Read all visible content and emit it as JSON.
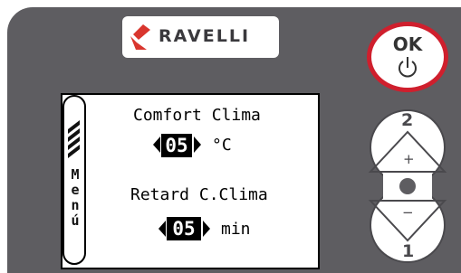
{
  "brand": {
    "name": "RAVELLI",
    "logo_color": "#d9362e"
  },
  "menu_tab": {
    "label_chars": [
      "M",
      "e",
      "n",
      "ú"
    ],
    "icon": "bars-icon"
  },
  "screen": {
    "setting1": {
      "label": "Comfort Clima",
      "value": "05",
      "unit": "°C"
    },
    "setting2": {
      "label": "Retard C.Clima",
      "value": "05",
      "unit": "min"
    }
  },
  "buttons": {
    "ok": {
      "label": "OK",
      "icon": "power-icon",
      "ring_color": "#cf1f2d"
    },
    "up": {
      "number": "2",
      "sign": "+"
    },
    "down": {
      "number": "1",
      "sign": "−"
    }
  },
  "colors": {
    "panel": "#5e5d61",
    "button_fill": "#ffffff"
  }
}
